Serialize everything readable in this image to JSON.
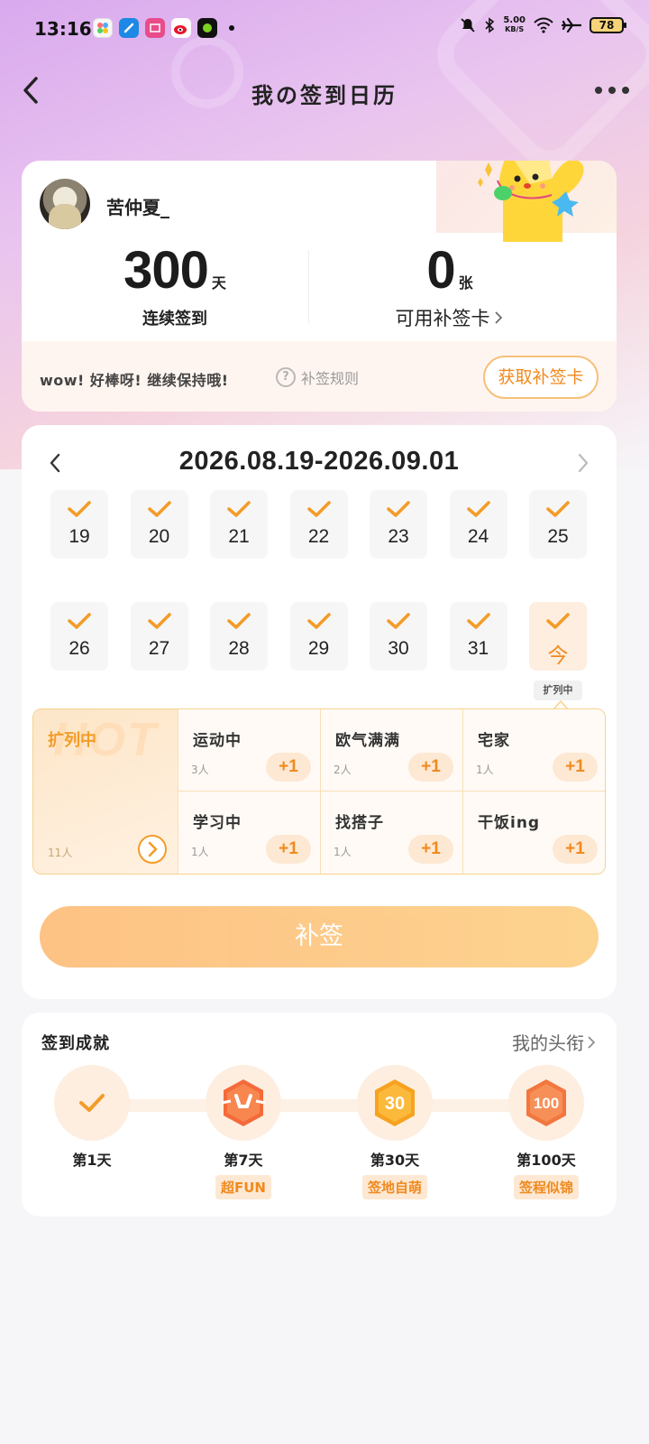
{
  "status_bar": {
    "time": "13:16",
    "net_speed_value": "5.00",
    "net_speed_unit": "KB/S",
    "battery": "78",
    "app_icons": [
      "gallery-app-icon",
      "browser-app-icon",
      "news-app-icon",
      "weibo-app-icon",
      "green-app-icon"
    ]
  },
  "header": {
    "title": "我の签到日历"
  },
  "profile": {
    "username": "苦仲夏_",
    "streak_value": "300",
    "streak_unit": "天",
    "streak_label": "连续签到",
    "cards_value": "0",
    "cards_unit": "张",
    "cards_label": "可用补签卡",
    "encourage_text": "wow! 好棒呀! 继续保持哦!",
    "rules_label": "补签规则",
    "get_card_label": "获取补签卡"
  },
  "calendar": {
    "range": "2026.08.19-2026.09.01",
    "week1": [
      "19",
      "20",
      "21",
      "22",
      "23",
      "24",
      "25"
    ],
    "week2": [
      "26",
      "27",
      "28",
      "29",
      "30",
      "31",
      "今"
    ],
    "today_tag": "扩列中"
  },
  "status_panel": {
    "hot_watermark": "HOT",
    "hot_title": "扩列中",
    "hot_count": "11人",
    "plus_label": "+1",
    "items": [
      {
        "name": "运动中",
        "count": "3人"
      },
      {
        "name": "欧气满满",
        "count": "2人"
      },
      {
        "name": "宅家",
        "count": "1人"
      },
      {
        "name": "学习中",
        "count": "1人"
      },
      {
        "name": "找搭子",
        "count": "1人"
      },
      {
        "name": "干饭ing",
        "count": ""
      }
    ]
  },
  "makeup_button": "补签",
  "achievements": {
    "title": "签到成就",
    "link_label": "我的头衔",
    "milestones": [
      {
        "label": "第1天",
        "badge": ""
      },
      {
        "label": "第7天",
        "badge": "超FUN"
      },
      {
        "label": "第30天",
        "badge": "签地自萌"
      },
      {
        "label": "第100天",
        "badge": "签程似锦"
      }
    ]
  },
  "colors": {
    "accent": "#f08a1e",
    "button_gradient_start": "#fdbf7e",
    "button_gradient_end": "#fdd18a",
    "panel_border": "#f6d28c"
  }
}
